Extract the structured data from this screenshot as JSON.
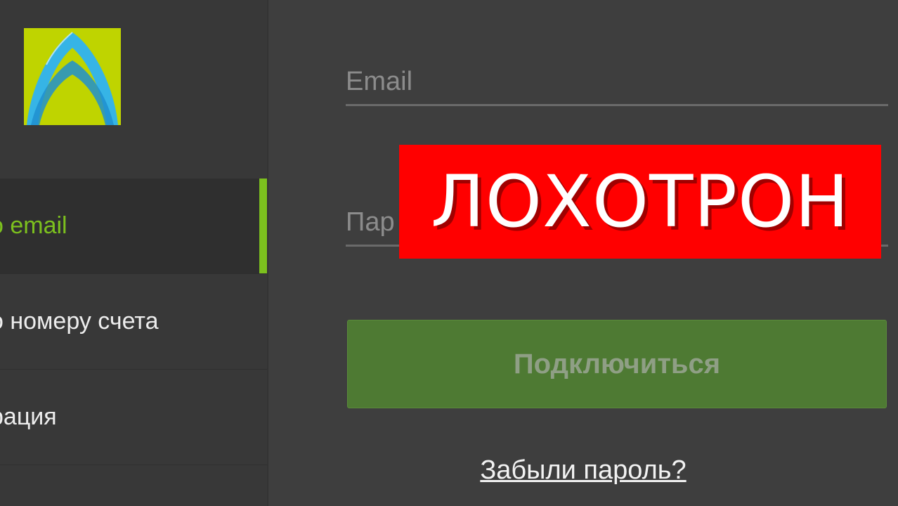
{
  "colors": {
    "background": "#3e3e3e",
    "sidebar": "#383838",
    "accent": "#7cc01e",
    "button": "#4e7a33",
    "stamp": "#ff0000"
  },
  "sidebar": {
    "logo_icon": "arch-logo-icon",
    "items": [
      {
        "label": "о email",
        "active": true
      },
      {
        "label": "о номеру счета",
        "active": false
      },
      {
        "label": "рация",
        "active": false
      }
    ]
  },
  "form": {
    "email_placeholder": "Email",
    "password_placeholder": "Пар",
    "connect_label": "Подключиться",
    "forgot_label": "Забыли пароль?"
  },
  "overlay": {
    "stamp_text": "ЛОХОТРОН"
  }
}
